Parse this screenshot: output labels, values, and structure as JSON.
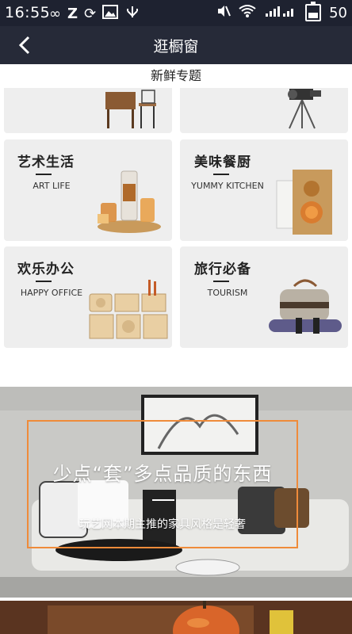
{
  "status_bar": {
    "time": "16:55",
    "battery": "50",
    "left_icons": [
      "infinity-icon",
      "z-icon",
      "sync-icon",
      "image-icon",
      "usb-icon"
    ],
    "right_icons": [
      "mute-icon",
      "wifi-icon",
      "signal-icon",
      "battery-icon"
    ]
  },
  "navbar": {
    "title": "逛橱窗",
    "back_icon": "chevron-left-icon"
  },
  "section": {
    "label": "新鲜专题"
  },
  "categories": [
    {
      "title": "艺术生活",
      "subtitle": "ART LIFE"
    },
    {
      "title": "美味餐厨",
      "subtitle": "YUMMY KITCHEN"
    },
    {
      "title": "欢乐办公",
      "subtitle": "HAPPY OFFICE"
    },
    {
      "title": "旅行必备",
      "subtitle": "TOURISM"
    }
  ],
  "banner": {
    "headline": "少点“套”多点品质的东西",
    "subtitle": "玩艺网本期主推的家具风格是轻奢",
    "frame_color": "#ef8b3a"
  },
  "colors": {
    "status_bar": "#1e2230",
    "navbar": "#262a38",
    "card_bg": "#eeeeee"
  }
}
